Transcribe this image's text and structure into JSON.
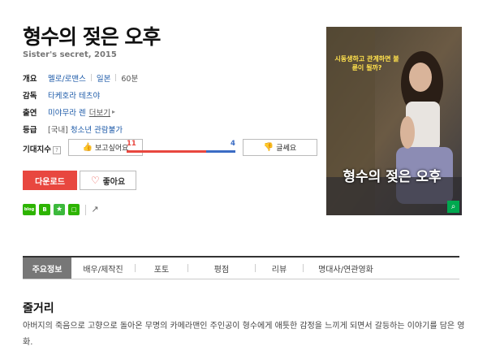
{
  "movie": {
    "title": "형수의 젖은 오후",
    "subtitle": "Sister's secret, 2015"
  },
  "info": {
    "overview_label": "개요",
    "genre": "멜로/로맨스",
    "country": "일본",
    "runtime": "60분",
    "director_label": "감독",
    "director": "타케호라 테츠야",
    "cast_label": "출연",
    "cast": "미야무라 렌",
    "more_label": "더보기",
    "rating_label": "등급",
    "rating_region": "[국내]",
    "rating": "청소년 관람불가"
  },
  "expectation": {
    "label": "기대지수",
    "help_icon": "?",
    "want_label": "보고싶어요",
    "like_count": "11",
    "dislike_count": "4",
    "like_ratio": 0.733,
    "dislike_label": "글쎄요"
  },
  "actions": {
    "download_label": "다운로드",
    "like_label": "좋아요"
  },
  "share": {
    "blog_text": "blog",
    "band_text": "B",
    "star_text": "★",
    "box_text": "□",
    "link_icon": "share-icon"
  },
  "poster": {
    "tagline": "시동생하고 관계하면 불륜이 될까?",
    "title_art": "형수의 젖은 오후",
    "search_icon": "search-icon"
  },
  "tabs": [
    {
      "label": "주요정보"
    },
    {
      "label": "배우/제작진"
    },
    {
      "label": "포토"
    },
    {
      "label": "평점"
    },
    {
      "label": "리뷰"
    },
    {
      "label": "명대사/연관영화"
    }
  ],
  "synopsis": {
    "heading": "줄거리",
    "text": "아버지의 죽음으로 고향으로 돌아온 무명의 카메라맨인 주인공이 형수에게 애틋한 감정을 느끼게 되면서 갈등하는 이야기를 담은 영화."
  },
  "colors": {
    "accent_red": "#e8473f",
    "accent_blue": "#3b6cc4",
    "link_blue": "#1c5aa8",
    "share_green": "#2db400"
  }
}
